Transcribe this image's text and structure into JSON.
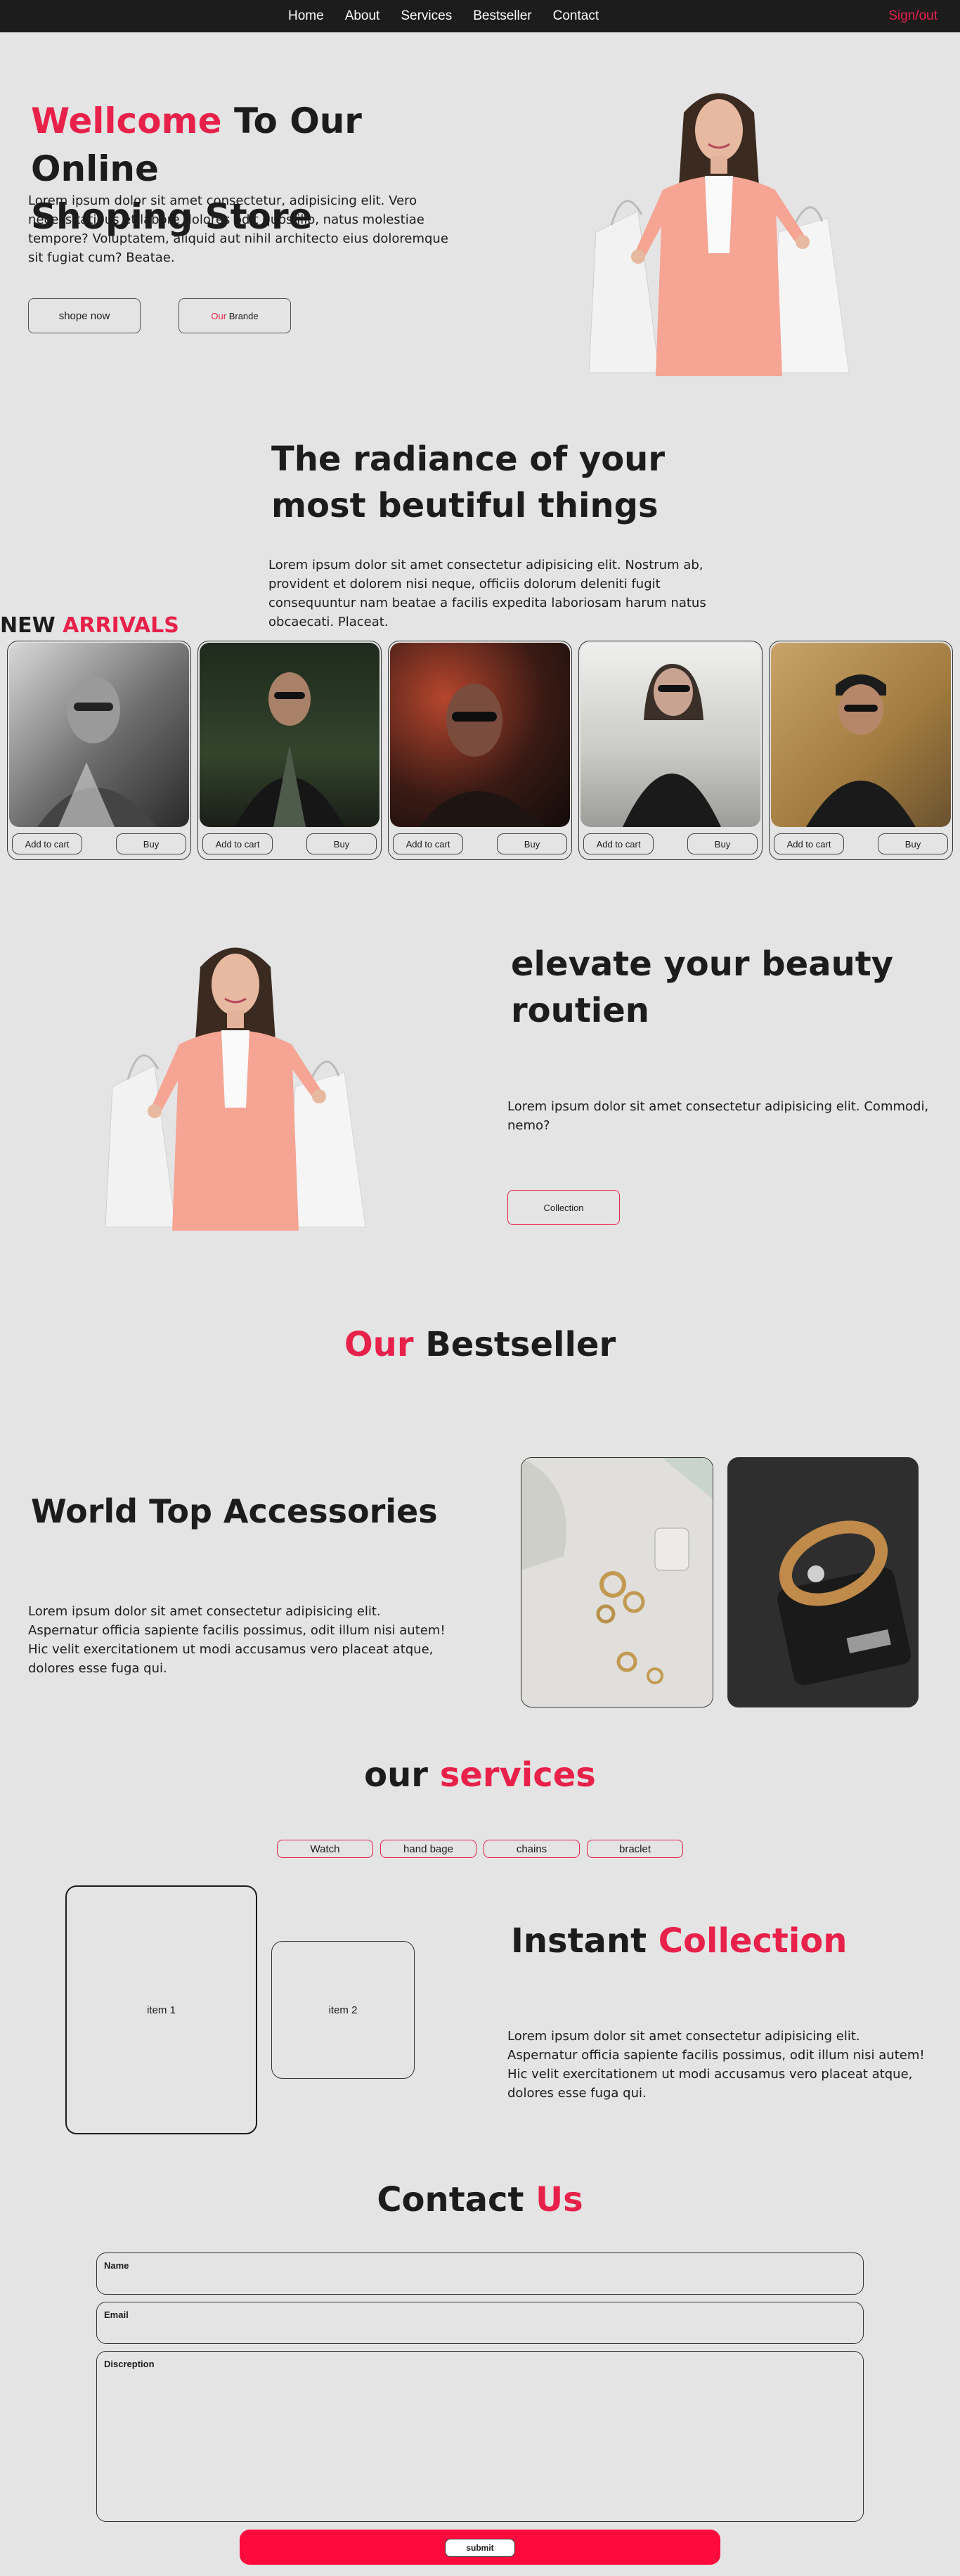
{
  "nav": {
    "links": [
      "Home",
      "About",
      "Services",
      "Bestseller",
      "Contact"
    ],
    "signout": "Sign/out"
  },
  "hero": {
    "title_accent": "Wellcome",
    "title_rest": "To Our Online",
    "title_line2": "Shoping Store",
    "text": "Lorem ipsum dolor sit amet consectetur, adipisicing elit. Vero necessitatibus et labore dolores odit quos illo, natus molestiae tempore? Voluptatem, aliquid aut nihil architecto eius doloremque sit fugiat cum? Beatae.",
    "shop_button": "shope now",
    "brands_accent": "Our",
    "brands_rest": "Brande"
  },
  "radiance": {
    "title_line1": "The radiance of your",
    "title_line2": "most beutiful things",
    "text": "Lorem ipsum dolor sit amet consectetur adipisicing elit. Nostrum ab, provident et dolorem nisi neque, officiis dolorum deleniti fugit consequuntur nam beatae a facilis expedita laboriosam harum natus obcaecati. Placeat."
  },
  "arrivals": {
    "title": "NEW",
    "title_accent": "ARRIVALS",
    "add_label": "Add to cart",
    "buy_label": "Buy",
    "cards": [
      {
        "photo": "man-sunglasses-bw"
      },
      {
        "photo": "man-dark-jacket"
      },
      {
        "photo": "woman-sunglasses-blur"
      },
      {
        "photo": "woman-leather-jacket"
      },
      {
        "photo": "man-cap-yellow-wall"
      }
    ]
  },
  "beauty": {
    "title_line1": "elevate your beauty",
    "title_line2": "routien",
    "text": "Lorem ipsum dolor sit amet consectetur adipisicing elit. Commodi, nemo?",
    "button": "Collection"
  },
  "bestseller": {
    "title_accent": "Our",
    "title_rest": "Bestseller"
  },
  "accessories": {
    "title": "World Top Accessories",
    "text": "Lorem ipsum dolor sit amet consectetur adipisicing elit. Aspernatur officia sapiente facilis possimus, odit illum nisi autem! Hic velit exercitationem ut modi accusamus vero placeat atque, dolores esse fuga qui."
  },
  "services": {
    "title": "our",
    "title_accent": "services",
    "tabs": [
      "Watch",
      "hand bage",
      "chains",
      "braclet"
    ],
    "item1": "item 1",
    "item2": "item 2",
    "collection_title": "Instant",
    "collection_accent": "Collection",
    "text": "Lorem ipsum dolor sit amet consectetur adipisicing elit. Aspernatur officia sapiente facilis possimus, odit illum nisi autem! Hic velit exercitationem ut modi accusamus vero placeat atque, dolores esse fuga qui."
  },
  "contact": {
    "title": "Contact",
    "title_accent": "Us",
    "name_label": "Name",
    "email_label": "Email",
    "desc_label": "Discreption",
    "submit": "submit"
  },
  "colors": {
    "accent": "#e8214a",
    "nav_bg": "#1c1c1c",
    "page_bg": "#e4e4e4",
    "submit_bar": "#ff0a3c"
  }
}
